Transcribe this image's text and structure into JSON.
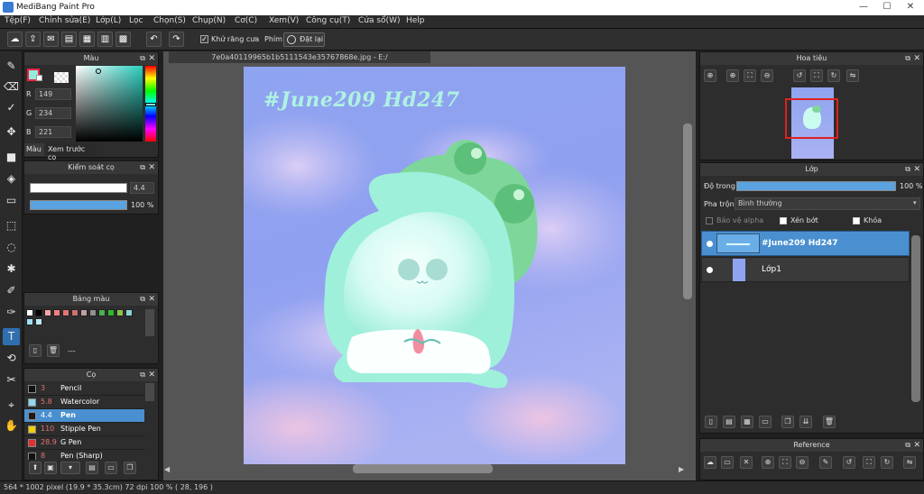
{
  "app": {
    "title": "MediBang Paint Pro"
  },
  "menu": [
    "Tệp(F)",
    "Chỉnh sửa(E)",
    "Lớp(L)",
    "Lọc",
    "Chọn(S)",
    "Chụp(N)",
    "Cơ(C)",
    "Xem(V)",
    "Công cụ(T)",
    "Cửa sổ(W)",
    "Help"
  ],
  "toolbar": {
    "antialias_label": "Khử răng cưa",
    "antialias_checked": true,
    "key_label": "Phím",
    "reset_label": "Đặt lại"
  },
  "color_panel": {
    "title": "Màu",
    "r_label": "R",
    "r": "149",
    "g_label": "G",
    "g": "234",
    "b_label": "B",
    "b": "221",
    "tab1": "Màu",
    "tab2": "Xem trước cọ",
    "fg_color": "#95eadd"
  },
  "brush_control": {
    "title": "Kiểm soát cọ",
    "size": "4.4",
    "opacity": "100 %"
  },
  "palette": {
    "title": "Bảng màu",
    "swatches": [
      "#ffffff",
      "#000000",
      "#f3a5a5",
      "#f08080",
      "#e57373",
      "#d07070",
      "#c0a0a0",
      "#909090",
      "#4caf50",
      "#2eb82e",
      "#8bc34a",
      "#8ad4d4",
      "#9fe0f0",
      "#bde9f5"
    ],
    "extra": "---"
  },
  "brush_panel": {
    "title": "Cọ",
    "items": [
      {
        "size": "3",
        "name": "Pencil",
        "swatch": "#111111"
      },
      {
        "size": "5.8",
        "name": "Watercolor",
        "swatch": "#8fd8f0"
      },
      {
        "size": "4.4",
        "name": "Pen",
        "swatch": "#1a1a1a",
        "selected": true
      },
      {
        "size": "110",
        "name": "Stipple Pen",
        "swatch": "#f0d000"
      },
      {
        "size": "28.9",
        "name": "G Pen",
        "swatch": "#e03030"
      },
      {
        "size": "8",
        "name": "Pen (Sharp)",
        "swatch": "#111111"
      }
    ]
  },
  "document": {
    "tab_title": "7e0a40119965b1b5111543e35767868e.jpg - E:/",
    "overlay_text": "#June209 Hd247"
  },
  "navigator": {
    "title": "Hoa tiêu"
  },
  "layers_panel": {
    "title": "Lớp",
    "opacity_label": "Độ trong",
    "opacity_value": "100 %",
    "blend_label": "Pha trộn",
    "blend_value": "Bình thường",
    "protect_alpha": "Bảo vệ alpha",
    "clipping": "Xén bớt",
    "lock": "Khóa",
    "layers": [
      {
        "name": "#June209 Hd247",
        "selected": true
      },
      {
        "name": "Lớp1",
        "selected": false
      }
    ]
  },
  "reference": {
    "title": "Reference"
  },
  "status": {
    "text": "564 * 1002 pixel   (19.9 * 35.3cm)   72 dpi   100 %   ( 28, 196 )"
  }
}
